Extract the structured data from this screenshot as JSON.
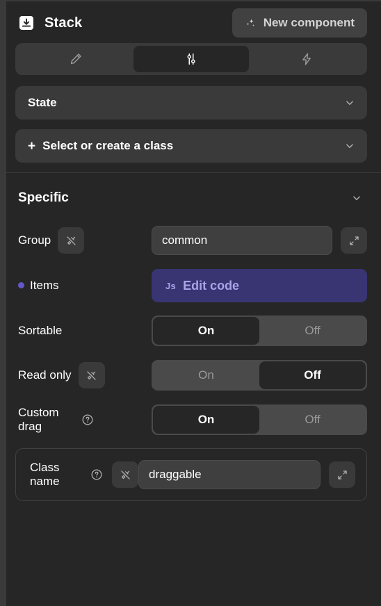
{
  "header": {
    "title": "Stack",
    "icon": "stack-download-icon",
    "new_component_label": "New component",
    "new_component_icon": "sparkles-icon"
  },
  "tabs": [
    {
      "name": "design",
      "icon": "pencil-icon",
      "active": false
    },
    {
      "name": "settings",
      "icon": "sliders-icon",
      "active": true
    },
    {
      "name": "actions",
      "icon": "lightning-bolt-icon",
      "active": false
    }
  ],
  "selects": {
    "state": {
      "label": "State",
      "chevron": "chevron-down-icon"
    },
    "class": {
      "label": "Select or create a class",
      "plus": "+",
      "chevron": "chevron-down-icon"
    }
  },
  "specific": {
    "title": "Specific",
    "chevron": "chevron-down-icon",
    "group": {
      "label": "Group",
      "value": "common",
      "unplug_icon": "plug-off-icon",
      "expand_icon": "expand-diagonal-icon"
    },
    "items": {
      "label": "Items",
      "marker_color": "#6357c9",
      "badge": "Js",
      "button_label": "Edit code",
      "button_bg": "#393472",
      "button_fg": "#a9a3e8"
    },
    "sortable": {
      "label": "Sortable",
      "on": "On",
      "off": "Off",
      "selected": "On"
    },
    "read_only": {
      "label": "Read only",
      "unplug_icon": "plug-off-icon",
      "on": "On",
      "off": "Off",
      "selected": "Off"
    },
    "custom_drag": {
      "label": "Custom drag",
      "help_icon": "help-circle-icon",
      "on": "On",
      "off": "Off",
      "selected": "On"
    },
    "class_name": {
      "label": "Class name",
      "help_icon": "help-circle-icon",
      "unplug_icon": "plug-off-icon",
      "value": "draggable",
      "expand_icon": "expand-diagonal-icon"
    }
  }
}
